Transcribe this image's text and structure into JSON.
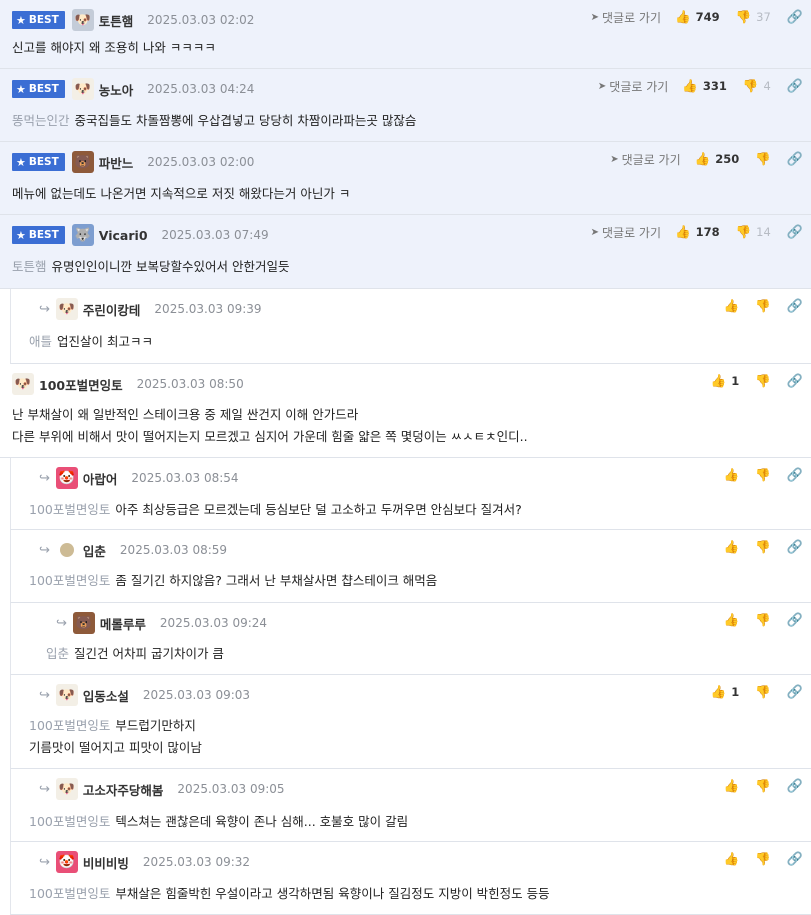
{
  "labels": {
    "best": "BEST",
    "goto": "댓글로 가기",
    "like_icon": "thumbs-up-icon",
    "dislike_icon": "thumbs-down-icon",
    "link_icon": "link-icon"
  },
  "colors": {
    "best_bg": "#eef2fb",
    "badge": "#3b6ed4",
    "mention": "#9aa1ad"
  },
  "comments": [
    {
      "best": true,
      "depth": 0,
      "avatar": "dog",
      "nick": "토튼햄",
      "date": "2025.03.03 02:02",
      "goto": true,
      "likes": "749",
      "dislikes": "37",
      "lines": [
        {
          "mention": "",
          "text": "신고를 해야지 왜 조용히 나와 ㅋㅋㅋㅋ"
        }
      ]
    },
    {
      "best": true,
      "depth": 0,
      "avatar": "pup",
      "nick": "농노아",
      "date": "2025.03.03 04:24",
      "goto": true,
      "likes": "331",
      "dislikes": "4",
      "lines": [
        {
          "mention": "똥먹는인간",
          "text": "중국집들도 차돌짬뽕에 우삽겹넣고 당당히 차짬이라파는곳 많잖슴"
        }
      ]
    },
    {
      "best": true,
      "depth": 0,
      "avatar": "bear",
      "nick": "파반느",
      "date": "2025.03.03 02:00",
      "goto": true,
      "likes": "250",
      "dislikes": "",
      "lines": [
        {
          "mention": "",
          "text": "메뉴에 없는데도 나온거면 지속적으로 저짓 해왔다는거 아닌가 ㅋ"
        }
      ]
    },
    {
      "best": true,
      "depth": 0,
      "avatar": "blue",
      "nick": "Vicari0",
      "date": "2025.03.03 07:49",
      "goto": true,
      "likes": "178",
      "dislikes": "14",
      "lines": [
        {
          "mention": "토튼햄",
          "text": "유명인인이니깐 보복당할수있어서 안한거일듯"
        }
      ]
    },
    {
      "best": false,
      "depth": 1,
      "avatar": "pup",
      "nick": "주린이캉테",
      "date": "2025.03.03 09:39",
      "goto": false,
      "likes": "",
      "dislikes": "",
      "lines": [
        {
          "mention": "애틀",
          "text": "업진살이 최고ㅋㅋ"
        }
      ]
    },
    {
      "best": false,
      "depth": 0,
      "avatar": "pup",
      "nick": "100포벌면잉토",
      "date": "2025.03.03 08:50",
      "goto": false,
      "likes": "1",
      "dislikes": "",
      "lines": [
        {
          "mention": "",
          "text": "난 부채살이 왜 일반적인 스테이크용 중 제일 싼건지 이해 안가드라"
        },
        {
          "mention": "",
          "text": "다른 부위에 비해서 맛이 떨어지는지 모르겠고 심지어 가운데 힘줄 얇은 쪽 몇덩이는 ㅆㅅㅌㅊ인디.."
        }
      ]
    },
    {
      "best": false,
      "depth": 1,
      "avatar": "clown",
      "nick": "아랍어",
      "date": "2025.03.03 08:54",
      "goto": false,
      "likes": "",
      "dislikes": "",
      "lines": [
        {
          "mention": "100포벌면잉토",
          "text": "아주 최상등급은 모르겠는데 등심보단 덜 고소하고 두꺼우면 안심보다 질겨서?"
        }
      ]
    },
    {
      "best": false,
      "depth": 1,
      "avatar": "dot",
      "nick": "입춘",
      "date": "2025.03.03 08:59",
      "goto": false,
      "likes": "",
      "dislikes": "",
      "lines": [
        {
          "mention": "100포벌면잉토",
          "text": "좀 질기긴 하지않음? 그래서 난 부채살사면 챱스테이크 해먹음"
        }
      ]
    },
    {
      "best": false,
      "depth": 2,
      "avatar": "bear",
      "nick": "메롤루루",
      "date": "2025.03.03 09:24",
      "goto": false,
      "likes": "",
      "dislikes": "",
      "lines": [
        {
          "mention": "입춘",
          "text": "질긴건 어차피 굽기차이가 큼"
        }
      ]
    },
    {
      "best": false,
      "depth": 1,
      "avatar": "pup",
      "nick": "입동소설",
      "date": "2025.03.03 09:03",
      "goto": false,
      "likes": "1",
      "dislikes": "",
      "lines": [
        {
          "mention": "100포벌면잉토",
          "text": "부드럽기만하지"
        },
        {
          "mention": "",
          "text": "기름맛이 떨어지고 피맛이 많이남"
        }
      ]
    },
    {
      "best": false,
      "depth": 1,
      "avatar": "pup",
      "nick": "고소자주당해봄",
      "date": "2025.03.03 09:05",
      "goto": false,
      "likes": "",
      "dislikes": "",
      "lines": [
        {
          "mention": "100포벌면잉토",
          "text": "텍스쳐는 괜찮은데 육향이 존나 심해... 호불호 많이 갈림"
        }
      ]
    },
    {
      "best": false,
      "depth": 1,
      "avatar": "clown",
      "nick": "비비비빙",
      "date": "2025.03.03 09:32",
      "goto": false,
      "likes": "",
      "dislikes": "",
      "lines": [
        {
          "mention": "100포벌면잉토",
          "text": "부채살은 힘줄박힌 우설이라고 생각하면됨 육향이나 질김정도 지방이 박힌정도 등등"
        }
      ]
    }
  ]
}
